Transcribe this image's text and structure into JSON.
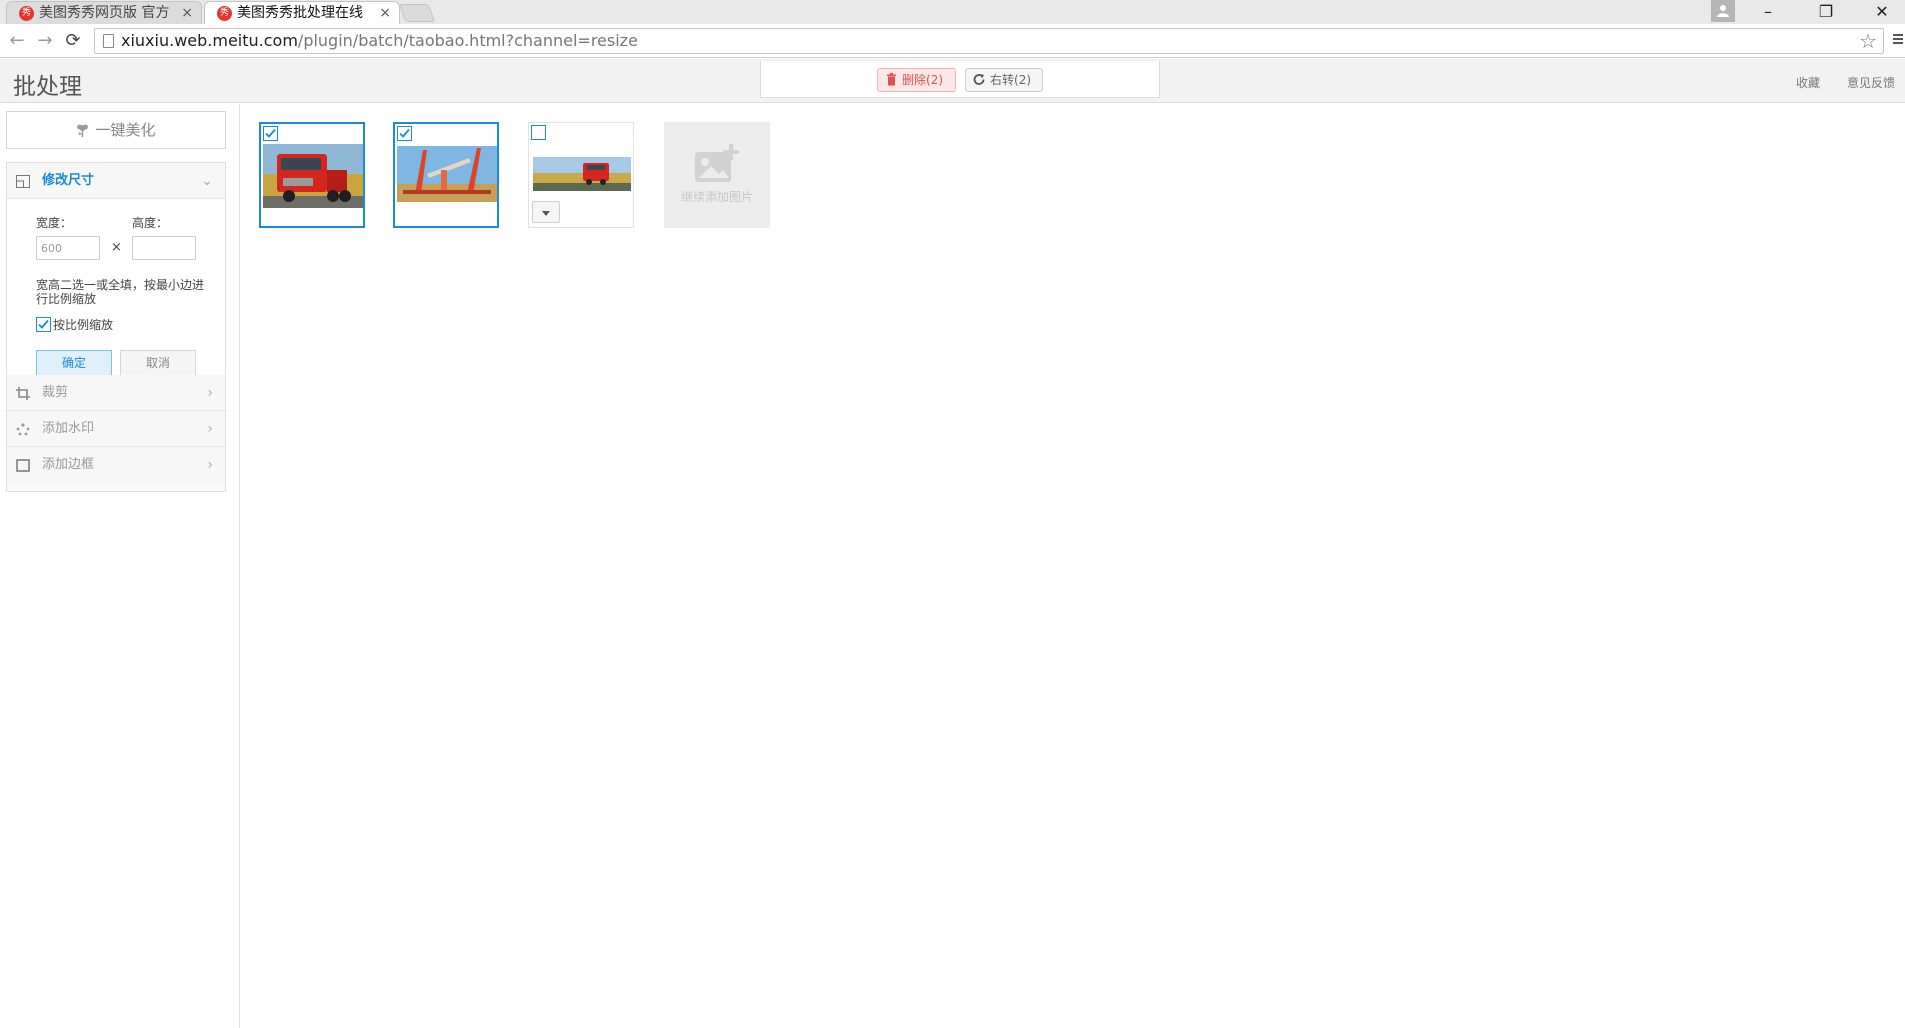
{
  "browser": {
    "tabs": [
      {
        "title": "美图秀秀网页版 官方",
        "favicon": "秀",
        "active": false
      },
      {
        "title": "美图秀秀批处理在线",
        "favicon": "秀",
        "active": true
      }
    ],
    "tab_close": "×",
    "url_host": "xiuxiu.web.meitu.com",
    "url_path": "/plugin/batch/taobao.html?channel=resize",
    "window_controls": {
      "minimize": "–",
      "restore": "❐",
      "close": "✕"
    }
  },
  "header": {
    "title": "批处理",
    "toolbar": {
      "delete_label": "删除",
      "delete_count": "(2)",
      "rotate_label": "右转",
      "rotate_count": "(2)"
    },
    "links": {
      "favorite": "收藏",
      "feedback": "意见反馈"
    }
  },
  "sidebar": {
    "beautify_label": "一键美化",
    "resize": {
      "label": "修改尺寸",
      "width_label": "宽度：",
      "height_label": "高度：",
      "width_value": "600",
      "height_value": "",
      "times": "×",
      "hint": "宽高二选一或全填，按最小边进行比例缩放",
      "keep_ratio_label": "按比例缩放",
      "keep_ratio_checked": true,
      "ok_label": "确定",
      "cancel_label": "取消"
    },
    "sections": [
      {
        "label": "裁剪",
        "icon": "crop-icon"
      },
      {
        "label": "添加水印",
        "icon": "watermark-icon"
      },
      {
        "label": "添加边框",
        "icon": "border-icon"
      }
    ],
    "chevron": "›",
    "chevron_down": "⌄"
  },
  "images": [
    {
      "name": "red-truck-photo",
      "checked": true
    },
    {
      "name": "crane-photo",
      "checked": true
    },
    {
      "name": "truck-landscape-photo",
      "checked": false
    }
  ],
  "add_tile_label": "继续添加图片",
  "colors": {
    "accent": "#1a8bd4",
    "delete": "#d9534f"
  }
}
